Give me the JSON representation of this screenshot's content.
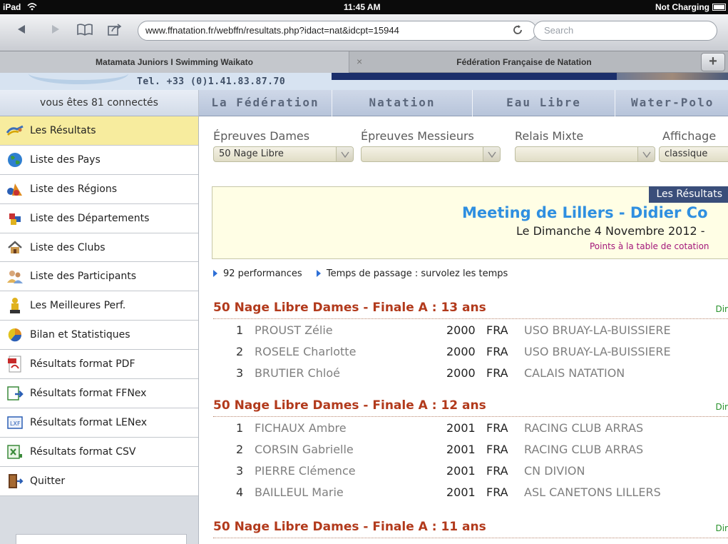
{
  "status_bar": {
    "device": "iPad",
    "time": "11:45 AM",
    "charge": "Not Charging"
  },
  "browser": {
    "url": "www.ffnatation.fr/webffn/resultats.php?idact=nat&idcpt=15944",
    "search_placeholder": "Search",
    "tabs": [
      {
        "label": "Matamata Juniors I Swimming Waikato"
      },
      {
        "label": "Fédération Française de Natation"
      }
    ]
  },
  "header": {
    "phone": "Tel. +33 (0)1.41.83.87.70",
    "connected": "vous êtes 81 connectés"
  },
  "nav": [
    "La Fédération",
    "Natation",
    "Eau Libre",
    "Water-Polo"
  ],
  "sidebar": {
    "items": [
      {
        "label": "Les Résultats",
        "icon": "swimmers-icon"
      },
      {
        "label": "Liste des Pays",
        "icon": "globe-icon"
      },
      {
        "label": "Liste des Régions",
        "icon": "regions-icon"
      },
      {
        "label": "Liste des Départements",
        "icon": "departments-icon"
      },
      {
        "label": "Liste des Clubs",
        "icon": "house-icon"
      },
      {
        "label": "Liste des Participants",
        "icon": "people-icon"
      },
      {
        "label": "Les Meilleures Perf.",
        "icon": "trophy-icon"
      },
      {
        "label": "Bilan et Statistiques",
        "icon": "chart-icon"
      },
      {
        "label": "Résultats format PDF",
        "icon": "pdf-icon"
      },
      {
        "label": "Résultats format FFNex",
        "icon": "ffnex-icon"
      },
      {
        "label": "Résultats format LENex",
        "icon": "lenex-icon"
      },
      {
        "label": "Résultats format CSV",
        "icon": "csv-icon"
      },
      {
        "label": "Quitter",
        "icon": "exit-door-icon"
      }
    ]
  },
  "filters": {
    "dames_label": "Épreuves Dames",
    "dames_value": "50 Nage Libre",
    "messieurs_label": "Épreuves Messieurs",
    "messieurs_value": "",
    "relais_label": "Relais Mixte",
    "relais_value": "",
    "affichage_label": "Affichage",
    "affichage_value": "classique"
  },
  "banner": {
    "tag": "Les Résultats",
    "title": "Meeting de Lillers - Didier Co",
    "date": "Le Dimanche 4 Novembre 2012 -",
    "points": "Points à la table de cotation"
  },
  "info": {
    "performances": "92 performances",
    "passage": "Temps de passage : survolez les temps"
  },
  "races": [
    {
      "title": "50 Nage Libre Dames - Finale A : 13 ans",
      "dir": "Dir",
      "rows": [
        {
          "rank": "1",
          "name": "PROUST Zélie",
          "year": "2000",
          "nat": "FRA",
          "club": "USO BRUAY-LA-BUISSIERE"
        },
        {
          "rank": "2",
          "name": "ROSELE Charlotte",
          "year": "2000",
          "nat": "FRA",
          "club": "USO BRUAY-LA-BUISSIERE"
        },
        {
          "rank": "3",
          "name": "BRUTIER Chloé",
          "year": "2000",
          "nat": "FRA",
          "club": "CALAIS NATATION"
        }
      ]
    },
    {
      "title": "50 Nage Libre Dames - Finale A : 12 ans",
      "dir": "Dir",
      "rows": [
        {
          "rank": "1",
          "name": "FICHAUX Ambre",
          "year": "2001",
          "nat": "FRA",
          "club": "RACING CLUB ARRAS"
        },
        {
          "rank": "2",
          "name": "CORSIN Gabrielle",
          "year": "2001",
          "nat": "FRA",
          "club": "RACING CLUB ARRAS"
        },
        {
          "rank": "3",
          "name": "PIERRE Clémence",
          "year": "2001",
          "nat": "FRA",
          "club": "CN DIVION"
        },
        {
          "rank": "4",
          "name": "BAILLEUL Marie",
          "year": "2001",
          "nat": "FRA",
          "club": "ASL CANETONS LILLERS"
        }
      ]
    },
    {
      "title": "50 Nage Libre Dames - Finale A : 11 ans",
      "dir": "Dir",
      "rows": []
    }
  ]
}
